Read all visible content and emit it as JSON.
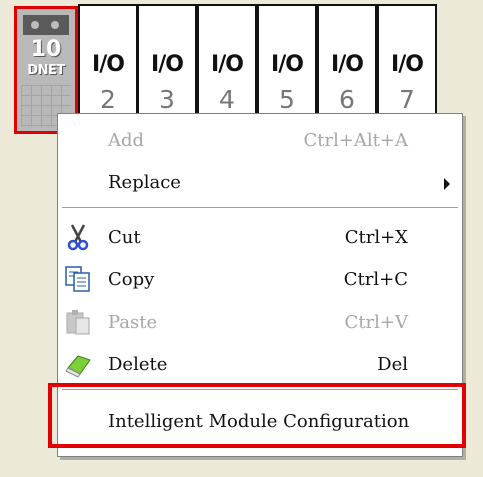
{
  "rack": {
    "module": {
      "slot_number": "10",
      "label": "DNET"
    },
    "slots": [
      {
        "type": "I/O",
        "number": "2"
      },
      {
        "type": "I/O",
        "number": "3"
      },
      {
        "type": "I/O",
        "number": "4"
      },
      {
        "type": "I/O",
        "number": "5"
      },
      {
        "type": "I/O",
        "number": "6"
      },
      {
        "type": "I/O",
        "number": "7"
      }
    ]
  },
  "context_menu": {
    "add": {
      "label": "Add",
      "shortcut": "Ctrl+Alt+A",
      "enabled": false
    },
    "replace": {
      "label": "Replace",
      "has_submenu": true
    },
    "cut": {
      "label": "Cut",
      "shortcut": "Ctrl+X",
      "icon": "scissors-icon"
    },
    "copy": {
      "label": "Copy",
      "shortcut": "Ctrl+C",
      "icon": "copy-icon"
    },
    "paste": {
      "label": "Paste",
      "shortcut": "Ctrl+V",
      "icon": "paste-icon",
      "enabled": false
    },
    "delete": {
      "label": "Delete",
      "shortcut": "Del",
      "icon": "eraser-icon"
    },
    "intelligent_module": {
      "label": "Intelligent Module Configuration",
      "highlighted": true
    }
  },
  "colors": {
    "highlight": "#e00000",
    "disabled_text": "#a7a7a7",
    "background": "#ece9d8"
  }
}
